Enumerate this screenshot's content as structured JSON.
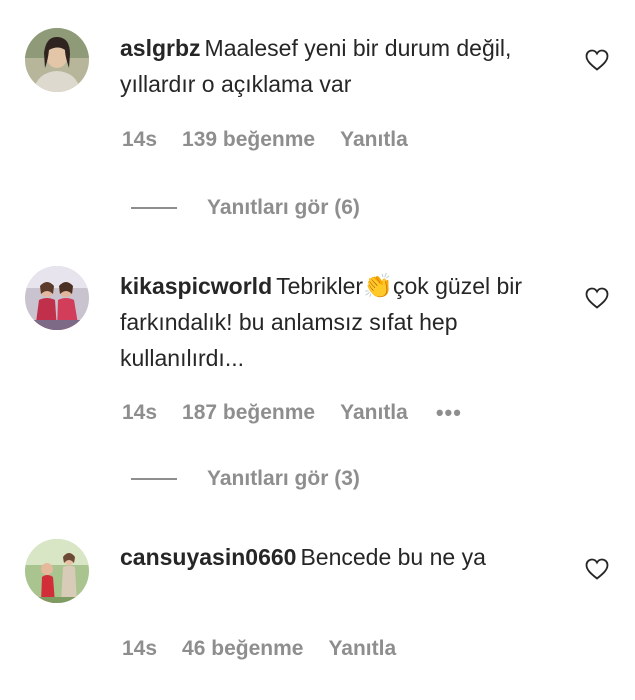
{
  "comments": [
    {
      "username": "aslgrbz",
      "text": "Maalesef yeni bir durum değil, yıllardır o açıklama var",
      "time": "14s",
      "likes": "139 beğenme",
      "reply": "Yanıtla",
      "view_replies": "Yanıtları gör (6)",
      "avatar_icon": "profile-photo-icon"
    },
    {
      "username": "kikaspicworld",
      "text_before": "Tebrikler",
      "emoji": "👏",
      "text_after": "çok güzel bir farkındalık! bu anlamsız sıfat hep kullanılırdı...",
      "time": "14s",
      "likes": "187 beğenme",
      "reply": "Yanıtla",
      "more": "•••",
      "view_replies": "Yanıtları gör (3)",
      "avatar_icon": "profile-photo-icon"
    },
    {
      "username": "cansuyasin0660",
      "text": "Bencede bu ne ya",
      "time": "14s",
      "likes": "46 beğenme",
      "reply": "Yanıtla",
      "avatar_icon": "profile-photo-icon"
    }
  ],
  "icons": {
    "like": "heart-icon",
    "more": "more-options-icon"
  },
  "colors": {
    "text": "#262626",
    "secondary": "#8e8e8e",
    "background": "#ffffff"
  }
}
